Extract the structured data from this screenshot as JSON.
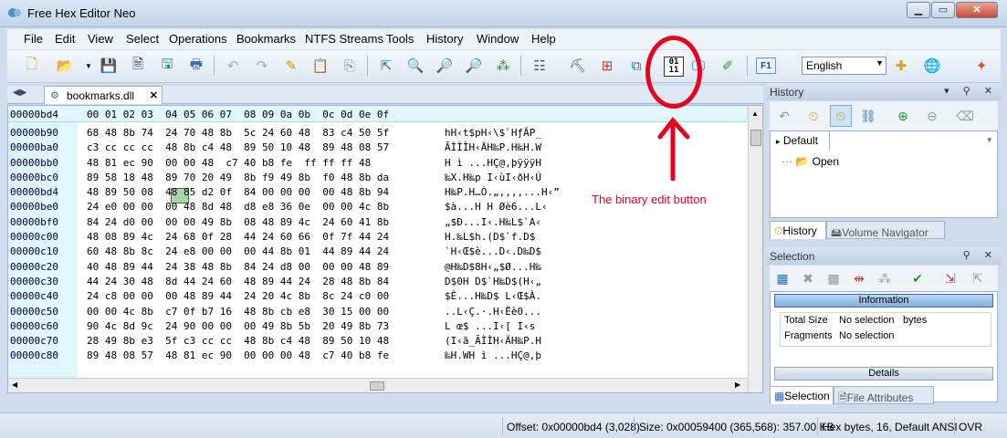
{
  "window": {
    "title": "Free Hex Editor Neo",
    "min": "▁",
    "max": "▭",
    "close": "✕"
  },
  "menu": [
    "File",
    "Edit",
    "View",
    "Select",
    "Operations",
    "Bookmarks",
    "NTFS Streams",
    "Tools",
    "History",
    "Window",
    "Help"
  ],
  "toolbar": {
    "language": "English",
    "binary_btn_top": "01",
    "binary_btn_bottom": "11",
    "f1": "F1"
  },
  "tab": {
    "label": "bookmarks.dll",
    "close": "✕",
    "nav": "◀▶"
  },
  "hex": {
    "header_offset": "00000bd4",
    "header_columns": "00 01 02 03  04 05 06 07  08 09 0a 0b  0c 0d 0e 0f",
    "offsets": [
      "00000b90",
      "00000ba0",
      "00000bb0",
      "00000bc0",
      "00000bd4",
      "00000be0",
      "00000bf0",
      "00000c00",
      "00000c10",
      "00000c20",
      "00000c30",
      "00000c40",
      "00000c50",
      "00000c60",
      "00000c70",
      "00000c80"
    ],
    "rows": [
      "68 48 8b 74  24 70 48 8b  5c 24 60 48  83 c4 50 5f",
      "c3 cc cc cc  48 8b c4 48  89 50 10 48  89 48 08 57",
      "48 81 ec 90  00 00 48  c7 40 b8 fe  ff ff ff 48",
      "89 58 18 48  89 70 20 49  8b f9 49 8b  f0 48 8b da",
      "48 89 50 08  48 85 d2 0f  84 00 00 00  00 48 8b 94",
      "24 e0 00 00  00 48 8d 48  d8 e8 36 0e  00 00 4c 8b",
      "84 24 d0 00  00 00 49 8b  08 48 89 4c  24 60 41 8b",
      "48 08 89 4c  24 68 0f 28  44 24 60 66  0f 7f 44 24",
      "60 48 8b 8c  24 e8 00 00  00 44 8b 01  44 89 44 24",
      "40 48 89 44  24 38 48 8b  84 24 d8 00  00 00 48 89",
      "44 24 30 48  8d 44 24 60  48 89 44 24  28 48 8b 84",
      "24 c8 00 00  00 48 89 44  24 20 4c 8b  8c 24 c0 00",
      "00 00 4c 8b  c7 0f b7 16  48 8b cb e8  30 15 00 00",
      "90 4c 8d 9c  24 90 00 00  00 49 8b 5b  20 49 8b 73",
      "28 49 8b e3  5f c3 cc cc  48 8b c4 48  89 50 10 48",
      "89 48 08 57  48 81 ec 90  00 00 00 48  c7 40 b8 fe"
    ],
    "ansi": [
      "hH‹t$pH‹\\$`HƒÄP_",
      "ÃÌÌÌH‹ÄH‰P.H‰H.W",
      "H ì ...HÇ@,þÿÿÿH",
      "‰X.H‰p I‹ùI‹ðH‹Ú",
      "H‰P.H…Ò.„,,,,...H‹”",
      "$à...H H Øè6...L‹",
      "„$Ð...I‹.H‰L$`A‹",
      "H.‰L$h.(D$`f.D$",
      "`H‹Œ$è...D‹.D‰D$",
      "@H‰D$8H‹„$Ø...H‰",
      "D$0H D$`H‰D$(H‹„",
      "$È...H‰D$ L‹Œ$À.",
      "..L‹Ç.·.H‹Ëè0...",
      "L œ$ ...I‹[ I‹s",
      "(I‹ã_ÃÌÌH‹ÄH‰P.H",
      "‰H.WH ì ...HÇ@,þ"
    ],
    "selected_byte": "48"
  },
  "annotation": {
    "label": "The binary edit button"
  },
  "history": {
    "title": "History",
    "root": "Default",
    "item": "Open",
    "tab_history": "History",
    "tab_volume": "Volume Navigator"
  },
  "selection": {
    "title": "Selection",
    "info_header": "Information",
    "details": "Details",
    "rows": [
      [
        "Total Size",
        "No selection",
        "bytes"
      ],
      [
        "Fragments",
        "No selection",
        ""
      ]
    ],
    "tab_selection": "Selection",
    "tab_file_attr": "File Attributes"
  },
  "status": {
    "offset": "Offset: 0x00000bd4 (3,028)",
    "size": "Size: 0x00059400 (365,568): 357.00 KB",
    "mode": "Hex bytes, 16, Default ANSI",
    "ovr": "OVR"
  }
}
